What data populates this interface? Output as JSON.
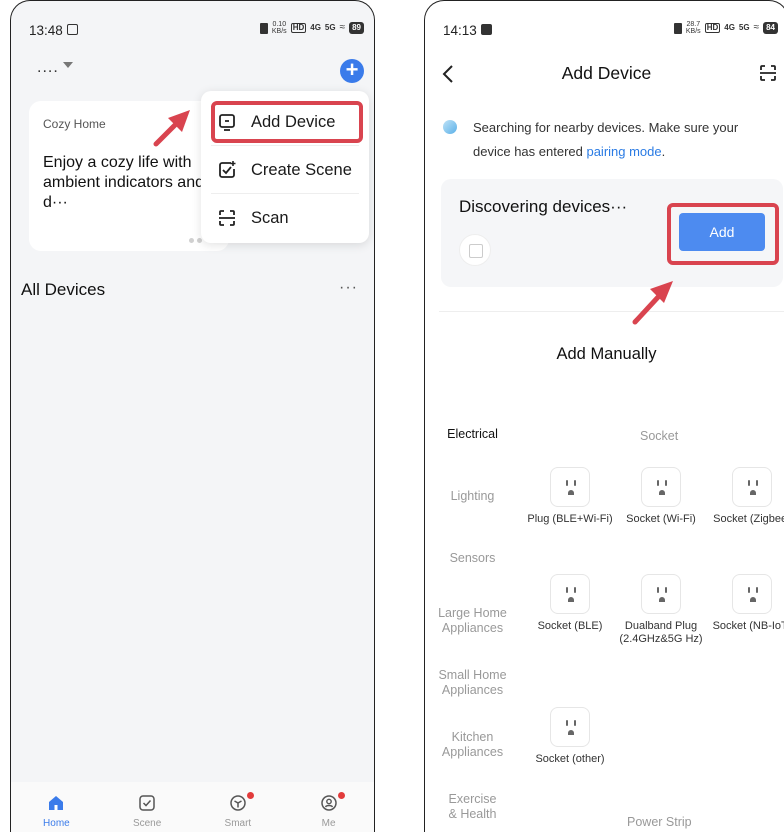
{
  "left_screen": {
    "status": {
      "time": "13:48",
      "battery": "89",
      "speed_top": "0.10",
      "speed_unit": "KB/s",
      "network_1": "4G",
      "network_2": "5G"
    },
    "home_selector": "....",
    "banner": {
      "subtitle": "Cozy Home",
      "title": "Enjoy a cozy life with ambient indicators and d···"
    },
    "menu": [
      {
        "label": "Add Device",
        "icon": "add-device-icon"
      },
      {
        "label": "Create Scene",
        "icon": "create-scene-icon"
      },
      {
        "label": "Scan",
        "icon": "scan-icon"
      }
    ],
    "section_title": "All Devices",
    "more": "···",
    "nav": [
      {
        "label": "Home",
        "icon": "home-icon",
        "active": true
      },
      {
        "label": "Scene",
        "icon": "scene-icon",
        "active": false
      },
      {
        "label": "Smart",
        "icon": "smart-icon",
        "active": false
      },
      {
        "label": "Me",
        "icon": "me-icon",
        "active": false
      }
    ]
  },
  "right_screen": {
    "status": {
      "time": "14:13",
      "battery": "84",
      "speed_top": "28.7",
      "speed_unit": "KB/s",
      "network_1": "4G",
      "network_2": "5G"
    },
    "title": "Add Device",
    "search_text": "Searching for nearby devices. Make sure your device has entered ",
    "search_link": "pairing mode",
    "search_end": ".",
    "discovering": "Discovering devices···",
    "add_button": "Add",
    "add_manually": "Add Manually",
    "categories": [
      "Electrical",
      "Lighting",
      "Sensors",
      "Large Home Appliances",
      "Small Home Appliances",
      "Kitchen Appliances",
      "Exercise & Health"
    ],
    "active_category": "Electrical",
    "socket_heading": "Socket",
    "power_strip_heading": "Power Strip",
    "devices": [
      {
        "label": "Plug (BLE+Wi-Fi)"
      },
      {
        "label": "Socket (Wi-Fi)"
      },
      {
        "label": "Socket (Zigbee)"
      },
      {
        "label": "Socket (BLE)"
      },
      {
        "label": "Dualband Plug (2.4GHz&5G Hz)"
      },
      {
        "label": "Socket (NB-IoT)"
      },
      {
        "label": "Socket (other)"
      }
    ]
  },
  "colors": {
    "accent": "#3a7bea",
    "highlight": "#d9444f",
    "add_button": "#4d8bf0",
    "link": "#2a7be4"
  }
}
